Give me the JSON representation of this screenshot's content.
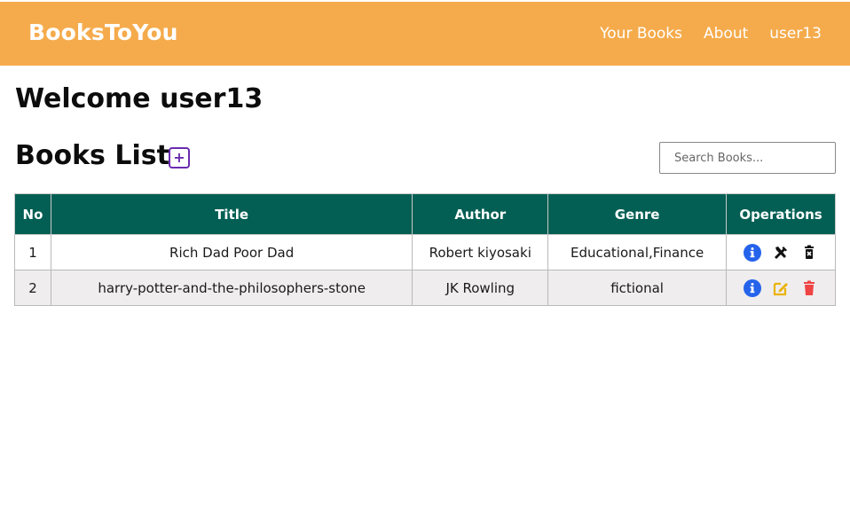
{
  "navbar": {
    "brand": "BooksToYou",
    "links": [
      "Your Books",
      "About",
      "user13"
    ],
    "background": "#f5ab4c"
  },
  "main": {
    "welcome": "Welcome user13",
    "list_title": "Books List",
    "add_icon": "plus-square-icon",
    "search": {
      "placeholder": "Search Books...",
      "value": ""
    }
  },
  "table": {
    "headers": [
      "No",
      "Title",
      "Author",
      "Genre",
      "Operations"
    ],
    "header_color": "#035f53",
    "rows": [
      {
        "no": "1",
        "title": "Rich Dad Poor Dad",
        "author": "Robert kiyosaki",
        "genre": "Educational,Finance",
        "ops": [
          "info-icon",
          "edit-tools-icon",
          "delete-icon"
        ]
      },
      {
        "no": "2",
        "title": "harry-potter-and-the-philosophers-stone",
        "author": "JK Rowling",
        "genre": "fictional",
        "ops": [
          "info-icon",
          "edit-icon",
          "delete-icon"
        ]
      }
    ],
    "op_colors": {
      "info": "#2563eb",
      "edit": "#eab308",
      "delete": "#ef4444",
      "dark": "#111111"
    }
  }
}
